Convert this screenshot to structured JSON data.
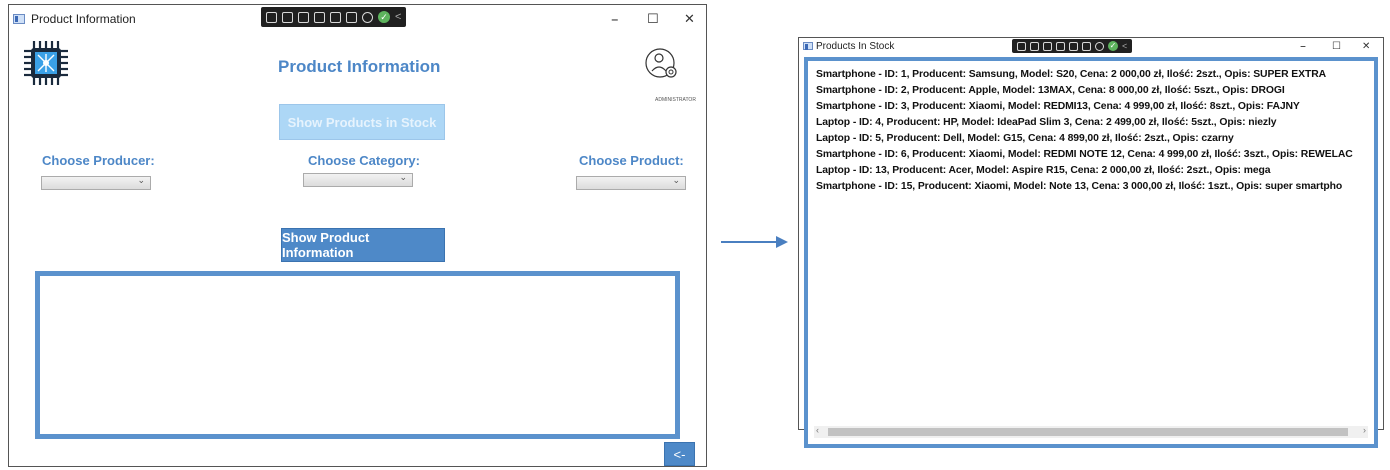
{
  "left_window": {
    "title": "Product Information",
    "heading": "Product Information",
    "show_stock_label": "Show Products in Stock",
    "producer_label": "Choose Producer:",
    "category_label": "Choose Category:",
    "product_label": "Choose Product:",
    "producer_value": "",
    "category_value": "",
    "product_value": "",
    "show_info_label": "Show Product Information",
    "admin_label": "ADMINISTRATOR",
    "back_label": "<-",
    "minimize": "–",
    "maximize": "☐",
    "close": "✕"
  },
  "right_window": {
    "title": "Products In Stock",
    "minimize": "–",
    "maximize": "☐",
    "close": "✕",
    "products": [
      "Smartphone - ID: 1, Producent: Samsung, Model: S20, Cena: 2 000,00 zł, Ilość: 2szt., Opis: SUPER EXTRA",
      "Smartphone - ID: 2, Producent: Apple, Model: 13MAX, Cena: 8 000,00 zł, Ilość: 5szt., Opis: DROGI",
      "Smartphone - ID: 3, Producent: Xiaomi, Model: REDMI13, Cena: 4 999,00 zł, Ilość: 8szt., Opis: FAJNY",
      "Laptop - ID: 4, Producent: HP, Model: IdeaPad Slim 3, Cena: 2 499,00 zł, Ilość: 5szt., Opis: niezly",
      "Laptop - ID: 5, Producent: Dell, Model: G15, Cena: 4 899,00 zł, Ilość: 2szt., Opis: czarny",
      "Smartphone - ID: 6, Producent: Xiaomi, Model: REDMI NOTE 12, Cena: 4 999,00 zł, Ilość: 3szt., Opis: REWELAC",
      "Laptop - ID: 13, Producent: Acer, Model: Aspire R15, Cena: 2 000,00 zł, Ilość: 2szt., Opis: mega",
      "Smartphone - ID: 15, Producent: Xiaomi, Model: Note 13, Cena: 3 000,00 zł, Ilość: 1szt., Opis: super smartpho"
    ]
  },
  "colors": {
    "accent": "#4e89c8",
    "accent_light": "#add7f6",
    "frame": "#5b92cd"
  },
  "icons": {
    "app_logo": "cpu-chip-icon",
    "admin": "admin-avatar-gear-icon",
    "arrow": "right-arrow-icon"
  }
}
